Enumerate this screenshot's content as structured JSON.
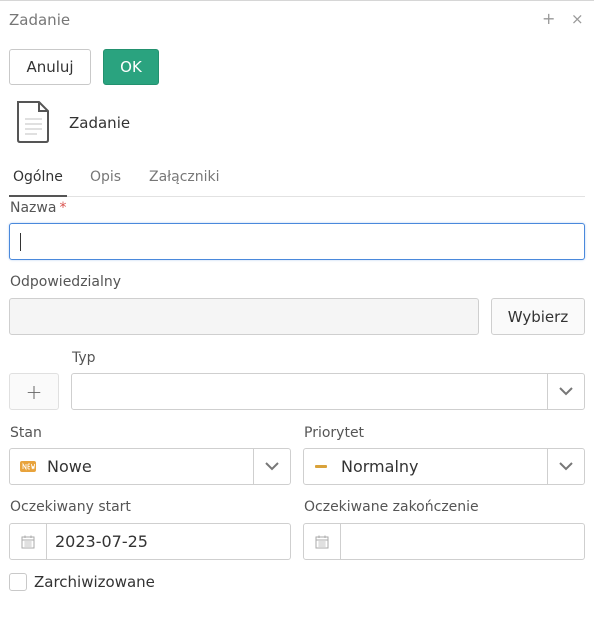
{
  "window": {
    "title": "Zadanie",
    "plus_glyph": "+",
    "close_glyph": "×"
  },
  "toolbar": {
    "cancel_label": "Anuluj",
    "ok_label": "OK"
  },
  "header": {
    "icon": "document-icon",
    "title": "Zadanie"
  },
  "tabs": [
    {
      "label": "Ogólne",
      "active": true
    },
    {
      "label": "Opis",
      "active": false
    },
    {
      "label": "Załączniki",
      "active": false
    }
  ],
  "form": {
    "nazwa": {
      "label": "Nazwa",
      "required_mark": "*",
      "value": ""
    },
    "odpowiedzialny": {
      "label": "Odpowiedzialny",
      "value": "",
      "button_label": "Wybierz"
    },
    "typ": {
      "label": "Typ",
      "value": "",
      "add_glyph": "+"
    },
    "stan": {
      "label": "Stan",
      "value": "Nowe",
      "icon": "new-badge-icon"
    },
    "priorytet": {
      "label": "Priorytet",
      "value": "Normalny",
      "icon": "priority-normal-icon"
    },
    "oczekiwany_start": {
      "label": "Oczekiwany start",
      "value": "2023-07-25"
    },
    "oczekiwane_zakonczenie": {
      "label": "Oczekiwane zakończenie",
      "value": ""
    },
    "zarchiwizowane": {
      "label": "Zarchiwizowane",
      "checked": false
    }
  },
  "colors": {
    "accent": "#2aa37f",
    "focus": "#4a89dc",
    "required": "#d9534f",
    "priority": "#d9a23a",
    "new_badge": "#e8a33c"
  }
}
